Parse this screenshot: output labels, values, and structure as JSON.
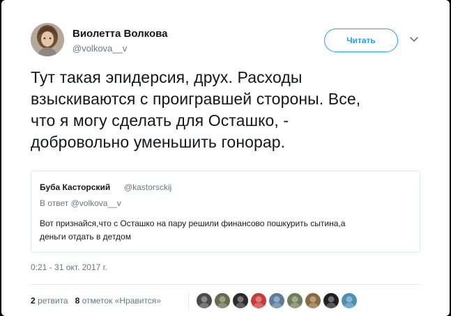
{
  "author": {
    "name": "Виолетта Волкова",
    "handle": "@volkova__v",
    "avatar_icon": "user-avatar"
  },
  "follow_button": {
    "label": "Читать"
  },
  "menu_icon": "chevron-down-icon",
  "tweet": {
    "text": "Тут такая эпидерсия, друх. Расходы\nвзыскиваются с проигравшей стороны. Все,\nчто я могу сделать для Осташко, -\nдобровольно уменьшить гонорар."
  },
  "quoted_tweet": {
    "author_name": "Буба Касторский",
    "author_handle": "@kastorsckij",
    "reply_to": "В ответ @volkova__v",
    "text": "Вот признайся,что с Осташко на пару решили финансово пошкурить сытина,а\nденьги отдать в детдом"
  },
  "timestamp": "0:21 - 31 окт. 2017 г.",
  "stats": {
    "retweets_count": "2",
    "retweets_label": "ретвита",
    "likes_count": "8",
    "likes_label": "отметок «Нравится»"
  },
  "likers": [
    {
      "name": "liker-1",
      "color": "#4a4a4a"
    },
    {
      "name": "liker-2",
      "color": "#6b6a4e"
    },
    {
      "name": "liker-3",
      "color": "#2b2b2b"
    },
    {
      "name": "liker-4",
      "color": "#c83a3a"
    },
    {
      "name": "liker-5",
      "color": "#5a7d9a"
    },
    {
      "name": "liker-6",
      "color": "#6e7f58"
    },
    {
      "name": "liker-7",
      "color": "#8a6a3c"
    },
    {
      "name": "liker-8",
      "color": "#1f1f1f"
    },
    {
      "name": "liker-9",
      "color": "#4c8fb5"
    }
  ],
  "colors": {
    "accent": "#1da1f2",
    "text_primary": "#14171a",
    "text_secondary": "#657786",
    "border": "#e1e8ed"
  }
}
